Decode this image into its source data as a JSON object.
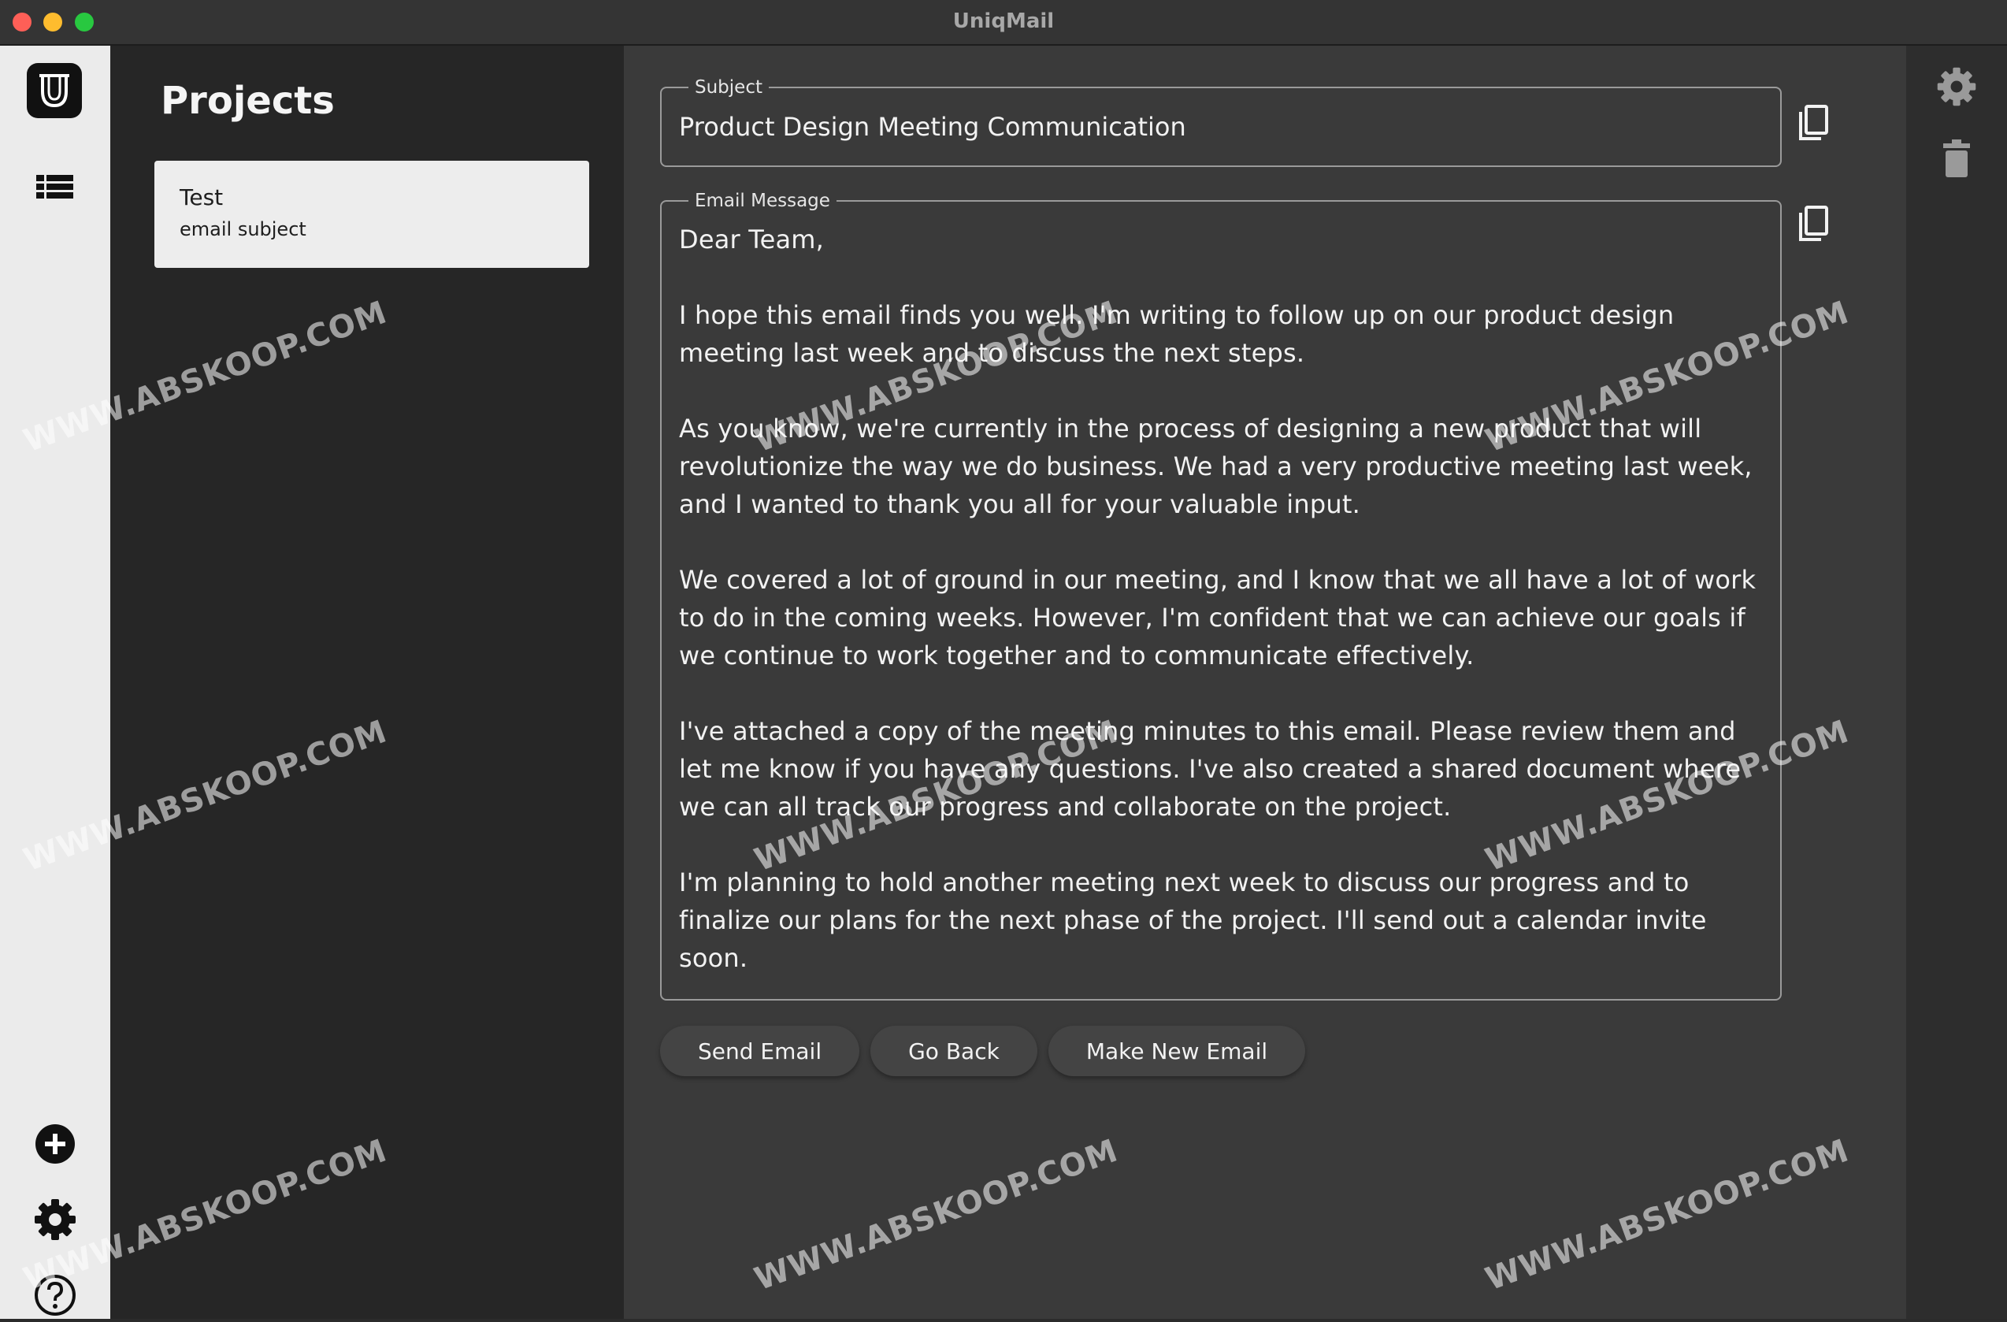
{
  "window": {
    "title": "UniqMail"
  },
  "sidebar": {
    "items": [
      {
        "name": "list-view",
        "icon": "list-icon"
      },
      {
        "name": "add",
        "icon": "plus-circle-icon"
      },
      {
        "name": "settings",
        "icon": "gear-icon"
      },
      {
        "name": "help",
        "icon": "question-circle-icon"
      }
    ]
  },
  "projects": {
    "title": "Projects",
    "items": [
      {
        "name": "Test",
        "subtitle": "email subject"
      }
    ]
  },
  "editor": {
    "subject_label": "Subject",
    "subject_value": "Product Design Meeting Communication",
    "message_label": "Email Message",
    "message_paragraphs": [
      "Dear Team,",
      "I hope this email finds you well. I'm writing to follow up on our product design meeting last week and to discuss the next steps.",
      "As you know, we're currently in the process of designing a new product that will revolutionize the way we do business. We had a very productive meeting last week, and I wanted to thank you all for your valuable input.",
      "We covered a lot of ground in our meeting, and I know that we all have a lot of work to do in the coming weeks. However, I'm confident that we can achieve our goals if we continue to work together and to communicate effectively.",
      "I've attached a copy of the meeting minutes to this email. Please review them and let me know if you have any questions. I've also created a shared document where we can all track our progress and collaborate on the project.",
      "I'm planning to hold another meeting next week to discuss our progress and to finalize our plans for the next phase of the project. I'll send out a calendar invite soon."
    ]
  },
  "actions": {
    "send_label": "Send Email",
    "back_label": "Go Back",
    "new_label": "Make New Email"
  },
  "tools": {
    "settings_icon": "gear-icon",
    "delete_icon": "trash-icon"
  },
  "watermark": "WWW.ABSKOOP.COM",
  "colors": {
    "rail": "#ebebeb",
    "projects_bg": "#262626",
    "main_bg": "#3a3a3a",
    "button_bg": "#444444"
  }
}
